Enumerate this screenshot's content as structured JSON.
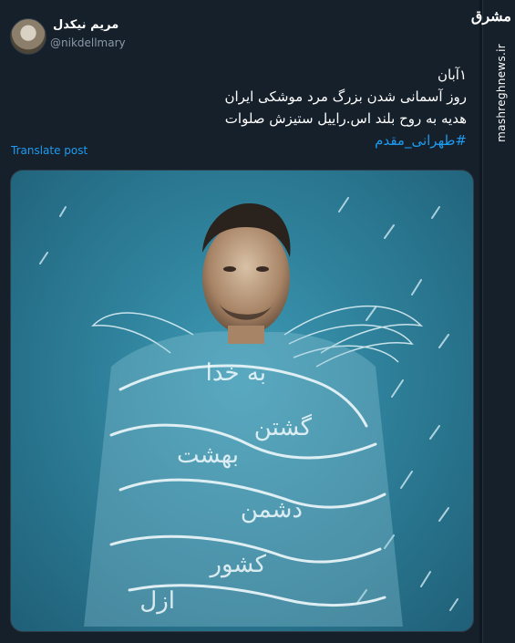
{
  "post": {
    "display_name": "مریم نیکدل",
    "handle": "@nikdellmary",
    "lines": [
      "۱آبان",
      "روز آسمانی شدن  بزرگ مرد موشکی ایران",
      "هدیه به روح بلند اس.راییل ستیزش صلوات"
    ],
    "hashtag": "#طهرانی_مقدم",
    "translate_label": "Translate post"
  },
  "media": {
    "calligraphy": [
      "به خدا",
      "گشتن",
      "بهشت",
      "دشمن",
      "کشور",
      "ازل"
    ]
  },
  "watermark": {
    "logo": "مشرق",
    "site": "mashreghnews.ir"
  },
  "colors": {
    "background": "#15202b",
    "link": "#1d9bf0",
    "image_teal": "#2e7f99"
  }
}
